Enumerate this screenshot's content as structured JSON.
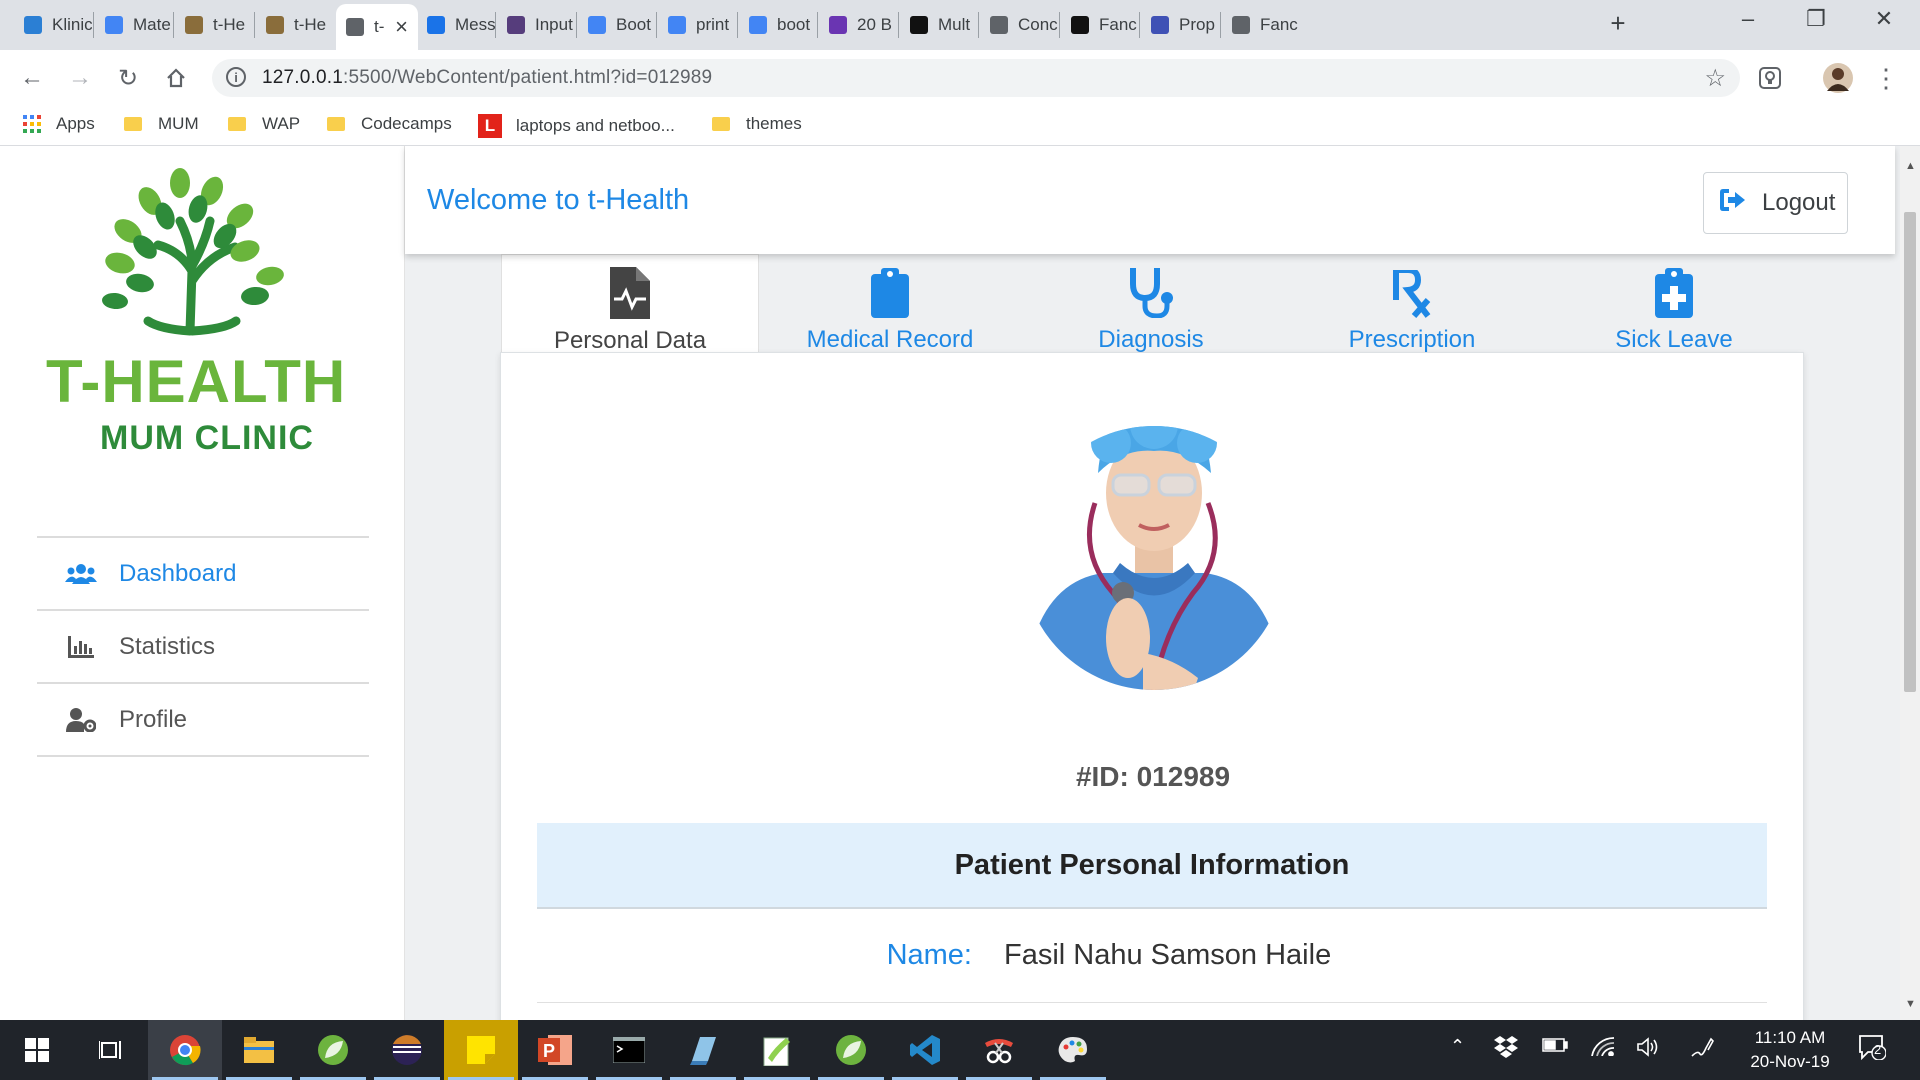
{
  "browser": {
    "tabs": [
      {
        "label": "Klinic",
        "icon": "klinic-favicon",
        "color": "#2b7fd4"
      },
      {
        "label": "Mate",
        "icon": "mdb-favicon",
        "color": "#4285f4"
      },
      {
        "label": "t-He",
        "icon": "image-favicon",
        "color": "#8a6d3b"
      },
      {
        "label": "t-He",
        "icon": "image-favicon",
        "color": "#8a6d3b"
      },
      {
        "label": "t-",
        "icon": "globe-favicon",
        "color": "#5f6368"
      },
      {
        "label": "Mess",
        "icon": "flag-favicon",
        "color": "#1a73e8"
      },
      {
        "label": "Input",
        "icon": "bootstrap-favicon",
        "color": "#563d7c"
      },
      {
        "label": "Boot",
        "icon": "mdb-favicon",
        "color": "#4285f4"
      },
      {
        "label": "print",
        "icon": "google-favicon",
        "color": "#4285f4"
      },
      {
        "label": "boot",
        "icon": "google-favicon",
        "color": "#4285f4"
      },
      {
        "label": "20 B",
        "icon": "colorlib-favicon",
        "color": "#6a35b2"
      },
      {
        "label": "Mult",
        "icon": "codepen-favicon",
        "color": "#111111"
      },
      {
        "label": "Conc",
        "icon": "wordpress-favicon",
        "color": "#5f6368"
      },
      {
        "label": "Fanc",
        "icon": "codepen-favicon",
        "color": "#111111"
      },
      {
        "label": "Prop",
        "icon": "avatar-favicon",
        "color": "#3f51b5"
      },
      {
        "label": "Fanc",
        "icon": "globe-favicon",
        "color": "#5f6368"
      }
    ],
    "active_tab_index": 4,
    "new_tab": "+",
    "url_host": "127.0.0.1",
    "url_rest": ":5500/WebContent/patient.html?id=012989",
    "bookmarks": [
      {
        "label": "Apps",
        "icon": "apps-grid-icon"
      },
      {
        "label": "MUM",
        "icon": "folder-icon"
      },
      {
        "label": "WAP",
        "icon": "folder-icon"
      },
      {
        "label": "Codecamps",
        "icon": "folder-icon"
      },
      {
        "label": "laptops and netboo...",
        "icon": "lenovo-favicon"
      },
      {
        "label": "themes",
        "icon": "folder-icon"
      }
    ]
  },
  "sidebar": {
    "brand_line1": "T-HEALTH",
    "brand_line2": "MUM CLINIC",
    "items": [
      {
        "label": "Dashboard",
        "icon": "users-icon",
        "active": true
      },
      {
        "label": "Statistics",
        "icon": "bar-chart-icon",
        "active": false
      },
      {
        "label": "Profile",
        "icon": "user-cog-icon",
        "active": false
      }
    ]
  },
  "header": {
    "welcome": "Welcome to t-Health",
    "logout": "Logout"
  },
  "tabs": [
    {
      "label": "Personal Data",
      "icon": "file-medical-icon",
      "active": true
    },
    {
      "label": "Medical Record",
      "icon": "clipboard-icon",
      "active": false
    },
    {
      "label": "Diagnosis",
      "icon": "stethoscope-icon",
      "active": false
    },
    {
      "label": "Prescription",
      "icon": "prescription-icon",
      "active": false
    },
    {
      "label": "Sick Leave",
      "icon": "clipboard-medical-icon",
      "active": false
    }
  ],
  "patient": {
    "id_text": "#ID: 012989",
    "section_title": "Patient Personal Information",
    "name_label": "Name:",
    "name_value": "Fasil Nahu Samson Haile"
  },
  "taskbar": {
    "time": "11:10 AM",
    "date": "20-Nov-19",
    "notifications": "2"
  },
  "colors": {
    "accent": "#1e88e5",
    "brand_light_green": "#6ab53c",
    "brand_dark_green": "#2e8b3a",
    "info_header_bg": "#e1f0fc"
  }
}
